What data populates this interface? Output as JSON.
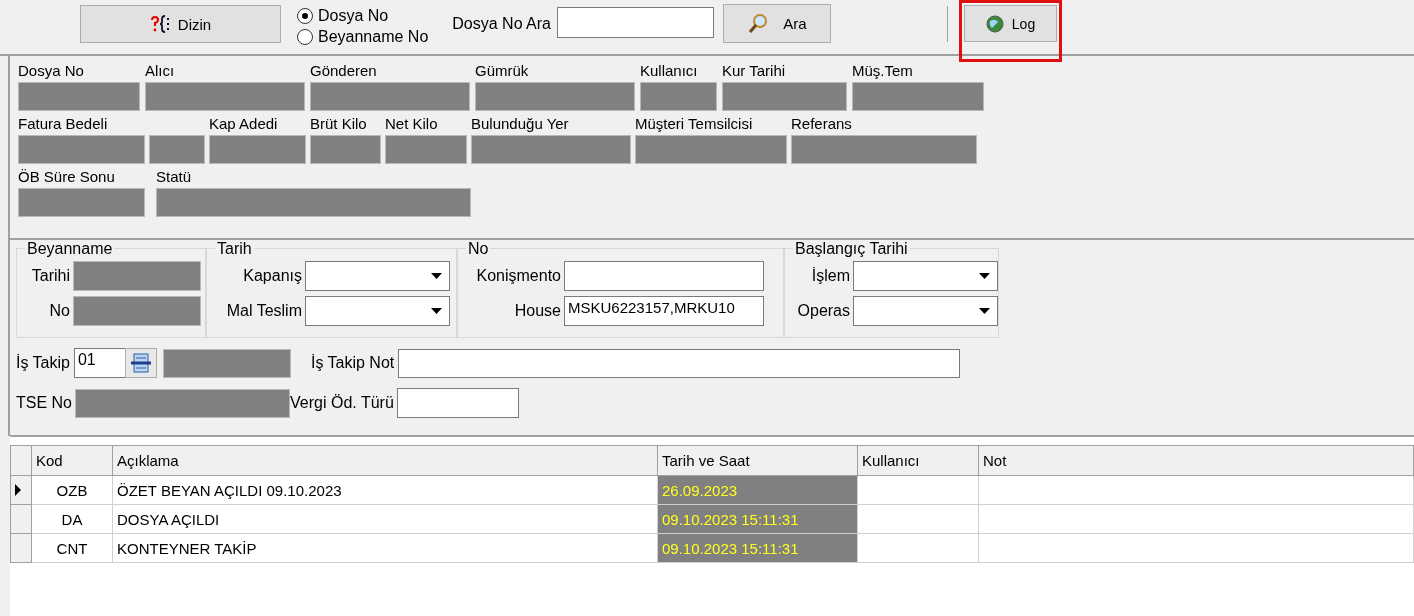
{
  "toolbar": {
    "dizin_button": "Dizin",
    "search_modes": [
      {
        "label": "Dosya No",
        "selected": true
      },
      {
        "label": "Beyanname No",
        "selected": false
      }
    ],
    "search_label": "Dosya No Ara",
    "ara_button": "Ara",
    "log_button": {
      "label": "Log",
      "highlighted": true
    }
  },
  "info_rows": [
    [
      {
        "label": "Dosya No"
      },
      {
        "label": "Alıcı"
      },
      {
        "label": "Gönderen"
      },
      {
        "label": "Gümrük"
      },
      {
        "label": "Kullanıcı"
      },
      {
        "label": "Kur Tarihi"
      },
      {
        "label": "Müş.Tem"
      }
    ],
    [
      {
        "label": "Fatura Bedeli"
      },
      {},
      {
        "label": "Kap Adedi"
      },
      {
        "label": "Brüt Kilo"
      },
      {
        "label": "Net Kilo"
      },
      {
        "label": "Bulunduğu Yer"
      },
      {
        "label": "Müşteri Temsilcisi"
      },
      {
        "label": "Referans"
      }
    ],
    [
      {
        "label": "ÖB Süre Sonu"
      },
      {
        "label": "Statü"
      }
    ]
  ],
  "groups": [
    {
      "title": "Beyanname",
      "fields": [
        {
          "label": "Tarihi",
          "kind": "readonly"
        },
        {
          "label": "No",
          "kind": "readonly"
        }
      ]
    },
    {
      "title": "Tarih",
      "fields": [
        {
          "label": "Kapanış",
          "kind": "dropdown"
        },
        {
          "label": "Mal Teslim",
          "kind": "dropdown"
        }
      ]
    },
    {
      "title": "No",
      "fields": [
        {
          "label": "Konişmento",
          "kind": "text"
        },
        {
          "label": "House",
          "kind": "text",
          "value": "MSKU6223157,MRKU10"
        }
      ]
    },
    {
      "title": "Başlangıç Tarihi",
      "fields": [
        {
          "label": "İşlem",
          "kind": "dropdown"
        },
        {
          "label": "Operas",
          "kind": "dropdown"
        }
      ]
    }
  ],
  "is_takip": {
    "label": "İş Takip",
    "value": "01",
    "note_label": "İş Takip Not"
  },
  "tse": {
    "label": "TSE No",
    "vergi_label": "Vergi Öd. Türü"
  },
  "grid": {
    "columns": [
      "Kod",
      "Açıklama",
      "Tarih ve Saat",
      "Kullanıcı",
      "Not"
    ],
    "rows": [
      {
        "selected": true,
        "cells": [
          "OZB",
          "ÖZET BEYAN AÇILDI 09.10.2023",
          "26.09.2023"
        ]
      },
      {
        "selected": false,
        "cells": [
          "DA",
          "DOSYA AÇILDI",
          "09.10.2023 15:11:31"
        ]
      },
      {
        "selected": false,
        "cells": [
          "CNT",
          "KONTEYNER TAKİP",
          "09.10.2023 15:11:31"
        ]
      }
    ]
  }
}
